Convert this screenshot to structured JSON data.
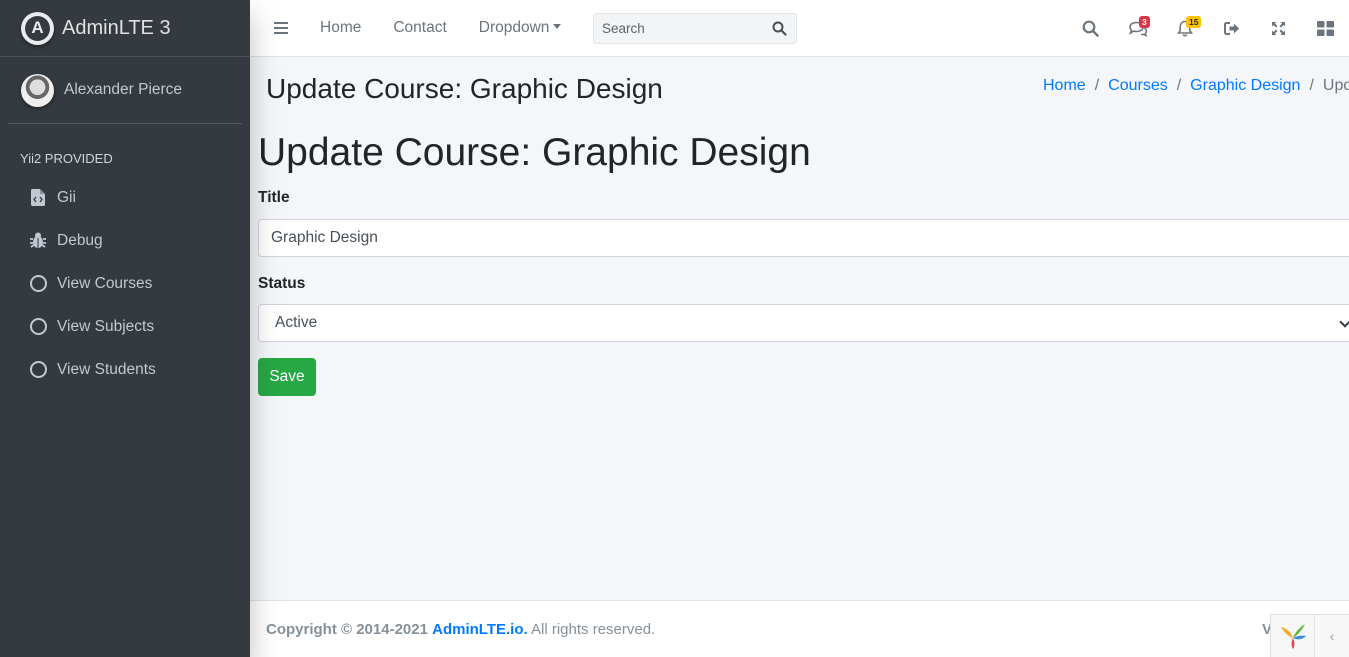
{
  "brand": {
    "name": "AdminLTE 3",
    "logo_letter": "A"
  },
  "user": {
    "name": "Alexander Pierce"
  },
  "sidebar": {
    "header": "Yii2 PROVIDED",
    "items": [
      {
        "label": "Gii",
        "icon": "file-code-icon"
      },
      {
        "label": "Debug",
        "icon": "bug-icon"
      },
      {
        "label": "View Courses",
        "icon": "circle-icon"
      },
      {
        "label": "View Subjects",
        "icon": "circle-icon"
      },
      {
        "label": "View Students",
        "icon": "circle-icon"
      }
    ]
  },
  "navbar": {
    "links": [
      "Home",
      "Contact",
      "Dropdown"
    ],
    "search_placeholder": "Search",
    "messages_count": "3",
    "notifications_count": "15"
  },
  "page": {
    "header_title": "Update Course: Graphic Design",
    "breadcrumb": [
      "Home",
      "Courses",
      "Graphic Design",
      "Update"
    ],
    "title": "Update Course: Graphic Design"
  },
  "form": {
    "title_label": "Title",
    "title_value": "Graphic Design",
    "status_label": "Status",
    "status_value": "Active",
    "save_label": "Save"
  },
  "footer": {
    "copyright_prefix": "Copyright © 2014-2021",
    "link_text": "AdminLTE.io.",
    "suffix": "All rights reserved.",
    "version_prefix": "V"
  },
  "colors": {
    "sidebar_bg": "#343a40",
    "accent_blue": "#007bff",
    "save_green": "#28a745",
    "badge_red": "#dc3545",
    "badge_yellow": "#ffc107"
  }
}
